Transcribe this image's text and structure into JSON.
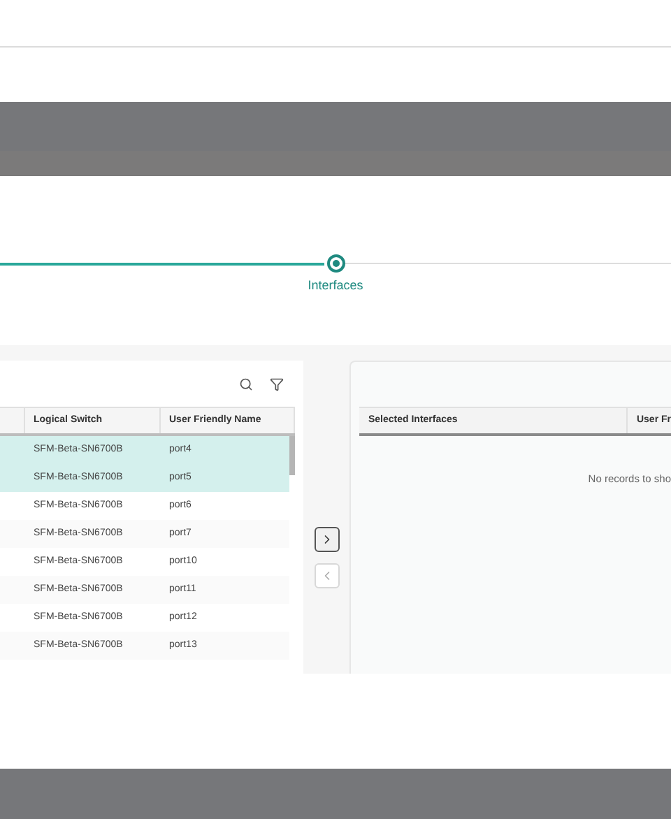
{
  "stepper": {
    "steps": [
      {
        "label": "Interfaces",
        "selected": true
      }
    ]
  },
  "available_table": {
    "columns": [
      "Logical Switch",
      "User Friendly Name"
    ],
    "rows": [
      {
        "switch": "SFM-Beta-SN6700B",
        "name": "port4",
        "selected": true
      },
      {
        "switch": "SFM-Beta-SN6700B",
        "name": "port5",
        "selected": true
      },
      {
        "switch": "SFM-Beta-SN6700B",
        "name": "port6",
        "selected": false
      },
      {
        "switch": "SFM-Beta-SN6700B",
        "name": "port7",
        "selected": false
      },
      {
        "switch": "SFM-Beta-SN6700B",
        "name": "port10",
        "selected": false
      },
      {
        "switch": "SFM-Beta-SN6700B",
        "name": "port11",
        "selected": false
      },
      {
        "switch": "SFM-Beta-SN6700B",
        "name": "port12",
        "selected": false
      },
      {
        "switch": "SFM-Beta-SN6700B",
        "name": "port13",
        "selected": false
      }
    ]
  },
  "transfer_buttons": [
    {
      "kind": "add",
      "disabled": false
    },
    {
      "kind": "remove",
      "disabled": true
    }
  ],
  "selected_table": {
    "columns": [
      "Selected Interfaces",
      "User Fr"
    ],
    "empty_message": "No records to sho"
  }
}
